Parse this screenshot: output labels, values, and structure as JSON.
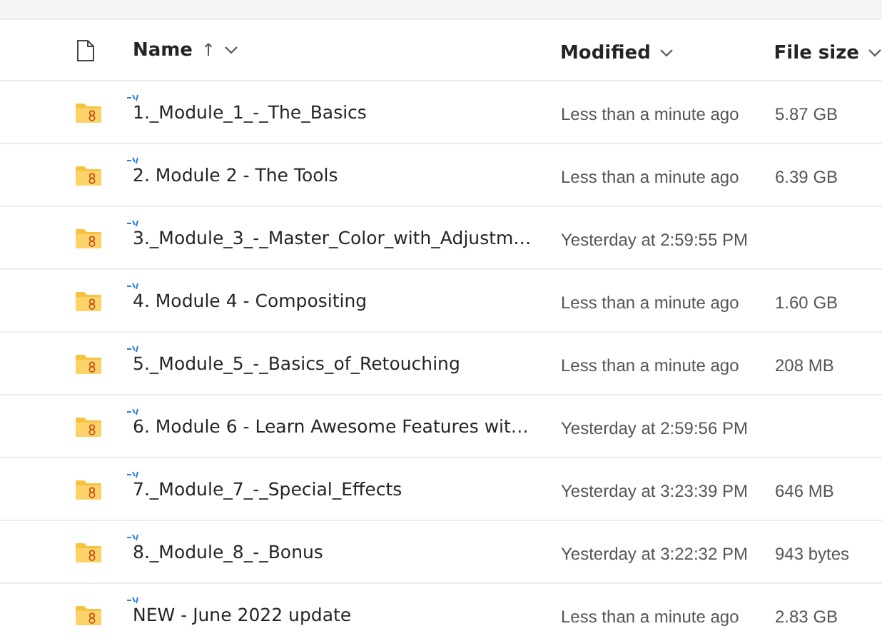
{
  "table": {
    "columns": [
      {
        "label": "Name",
        "sort_arrow": "↑"
      },
      {
        "label": "Modified"
      },
      {
        "label": "File size"
      }
    ],
    "rows": [
      {
        "name": "1._Module_1_-_The_Basics",
        "modified": "Less than a minute ago",
        "size": "5.87 GB"
      },
      {
        "name": "2. Module 2 - The Tools",
        "modified": "Less than a minute ago",
        "size": "6.39 GB"
      },
      {
        "name": "3._Module_3_-_Master_Color_with_Adjustm…",
        "modified": "Yesterday at 2:59:55 PM"
      },
      {
        "name": "4. Module 4 - Compositing",
        "modified": "Less than a minute ago",
        "size": "1.60 GB"
      },
      {
        "name": "5._Module_5_-_Basics_of_Retouching",
        "modified": "Less than a minute ago",
        "size": "208 MB"
      },
      {
        "name": "6. Module 6 - Learn Awesome Features wit…",
        "modified": "Yesterday at 2:59:56 PM"
      },
      {
        "name": "7._Module_7_-_Special_Effects",
        "modified": "Yesterday at 3:23:39 PM",
        "size": "646 MB"
      },
      {
        "name": "8._Module_8_-_Bonus",
        "modified": "Yesterday at 3:22:32 PM",
        "size": "943 bytes"
      },
      {
        "name": "NEW - June 2022 update",
        "modified": "Less than a minute ago",
        "size": "2.83 GB"
      }
    ]
  }
}
